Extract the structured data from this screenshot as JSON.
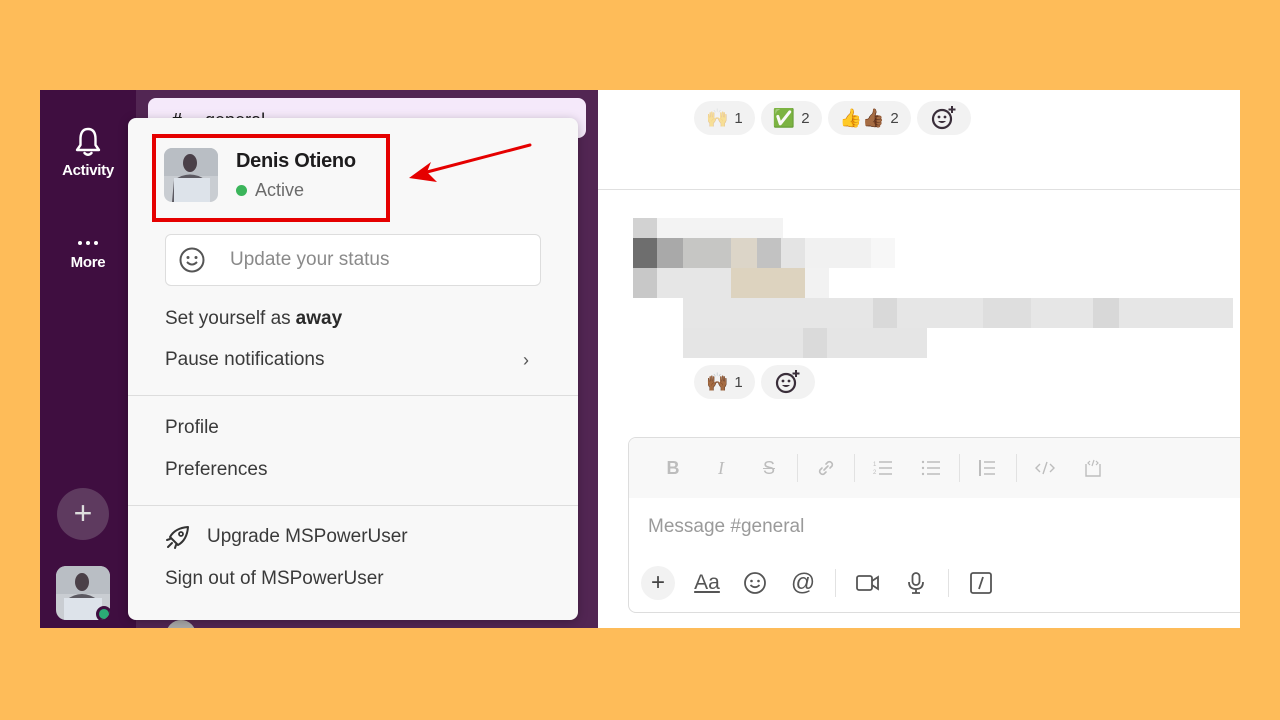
{
  "rail": {
    "activity_label": "Activity",
    "more_label": "More",
    "add_label": "+",
    "presence_color": "#2BAC76"
  },
  "channel": {
    "hash": "#",
    "name": "general"
  },
  "menu": {
    "user_name": "Denis Otieno",
    "status_text": "Active",
    "status_color": "#3BB55B",
    "status_placeholder": "Update your status",
    "set_away_prefix": "Set yourself as",
    "set_away_bold": "away",
    "pause_notifications": "Pause notifications",
    "pause_chevron": "›",
    "profile": "Profile",
    "preferences": "Preferences",
    "upgrade": "Upgrade MSPowerUser",
    "sign_out": "Sign out of MSPowerUser",
    "highlight_color": "#E50000"
  },
  "messages": {
    "top_reactions": [
      {
        "emoji": "🙌",
        "count": "1",
        "name": "raised-hands"
      },
      {
        "emoji": "✅",
        "count": "2",
        "name": "check-mark"
      },
      {
        "emoji": "👍👍🏾",
        "count": "2",
        "name": "thumbs-up"
      }
    ],
    "bottom_reactions": [
      {
        "emoji": "🙌🏾",
        "count": "1",
        "name": "raised-hands"
      }
    ]
  },
  "composer": {
    "placeholder": "Message #general",
    "format_buttons": [
      "B",
      "I",
      "S",
      "link",
      "ordered-list",
      "bulleted-list",
      "blockquote",
      "code",
      "code-block"
    ],
    "aa_label": "Aa",
    "at_label": "@",
    "plus_label": "+"
  },
  "colors": {
    "background": "#FEBC59",
    "rail": "#3F0E40",
    "sidebar": "#522653",
    "channel_pill": "#F5E9FA"
  }
}
